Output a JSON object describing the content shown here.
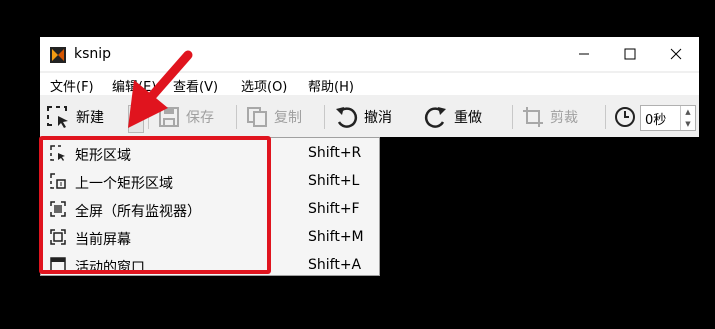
{
  "window": {
    "title": "ksnip"
  },
  "colors": {
    "highlight": "#e0141e",
    "arrow": "#e0141e"
  },
  "menubar": {
    "items": [
      "文件(F)",
      "编辑(E)",
      "查看(V)",
      "选项(O)",
      "帮助(H)"
    ]
  },
  "toolbar": {
    "new_label": "新建",
    "save_label": "保存",
    "copy_label": "复制",
    "undo_label": "撤消",
    "redo_label": "重做",
    "crop_label": "剪裁",
    "delay_value": "0秒"
  },
  "capture_menu": {
    "items": [
      {
        "label": "矩形区域",
        "shortcut": "Shift+R",
        "icon": "rect-region-icon"
      },
      {
        "label": "上一个矩形区域",
        "shortcut": "Shift+L",
        "icon": "last-rect-region-icon"
      },
      {
        "label": "全屏（所有监视器）",
        "shortcut": "Shift+F",
        "icon": "fullscreen-icon"
      },
      {
        "label": "当前屏幕",
        "shortcut": "Shift+M",
        "icon": "current-screen-icon"
      },
      {
        "label": "活动的窗口",
        "shortcut": "Shift+A",
        "icon": "active-window-icon"
      }
    ]
  }
}
